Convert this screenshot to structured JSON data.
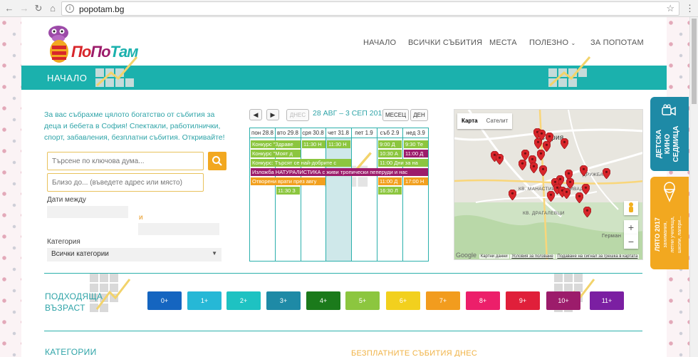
{
  "browser": {
    "url": "popotam.bg",
    "back_icon": "arrow-left-icon",
    "forward_icon": "arrow-right-icon",
    "reload_icon": "reload-icon",
    "home_icon": "home-icon"
  },
  "logo": {
    "text_parts": [
      "По",
      "По",
      "Там"
    ]
  },
  "nav": {
    "items": [
      "НАЧАЛО",
      "ВСИЧКИ СЪБИТИЯ",
      "МЕСТА",
      "ПОЛЕЗНО",
      "ЗА ПОПОТАМ"
    ]
  },
  "banner": {
    "title": "НАЧАЛО"
  },
  "intro": {
    "text": "За вас събрахме цялото богатство от събития за деца и бебета в София! Спектакли, работилнички, спорт, забавления, безплатни събития. Откривайте!"
  },
  "search": {
    "keyword_placeholder": "Търсене по ключова дума...",
    "near_placeholder": "Близо до... (въведете адрес или място)",
    "dates_label": "Дати между",
    "and_label": "и",
    "category_label": "Категория",
    "category_value": "Всички категории"
  },
  "calendar": {
    "today_label": "ДНЕС",
    "range": "28 АВГ – 3 СЕП 2017",
    "month_label": "МЕСЕЦ",
    "day_label": "ДЕН",
    "days": [
      "пон 28.8",
      "вто 29.8",
      "сря 30.8",
      "чет 31.8",
      "пет 1.9",
      "съб 2.9",
      "нед 3.9"
    ],
    "events": [
      {
        "text": "Конкурс \"Здраве",
        "color": "#8cc63f"
      },
      {
        "text": "Конкурс \"Моят д",
        "color": "#8cc63f"
      },
      {
        "text": "Конкурс: Търсят се най-добрите с",
        "color": "#8cc63f"
      },
      {
        "text": "11:30 Н",
        "color": "#8cc63f"
      },
      {
        "text": "11:30 Н",
        "color": "#8cc63f"
      },
      {
        "text": "9:00 Д",
        "color": "#8cc63f"
      },
      {
        "text": "9:30 Те",
        "color": "#8cc63f"
      },
      {
        "text": "10:30 А",
        "color": "#8cc63f"
      },
      {
        "text": "11:00 Д",
        "color": "#9c1c6b"
      },
      {
        "text": "11:00 Дни за на",
        "color": "#8cc63f"
      },
      {
        "text": "Изложба НАТУРАЛИСТИКА с живи тропически пеперуди и нас",
        "color": "#9c1c6b"
      },
      {
        "text": "Отворени врати през авгу",
        "color": "#f2a01e"
      },
      {
        "text": "11:00 Д",
        "color": "#f2a01e"
      },
      {
        "text": "17:00 Н",
        "color": "#f2a01e"
      },
      {
        "text": "11:30 З",
        "color": "#8cc63f"
      },
      {
        "text": "16:30 Л",
        "color": "#8cc63f"
      }
    ]
  },
  "map": {
    "tab_map": "Карта",
    "tab_satellite": "Сателит",
    "city_label": "София",
    "district_labels": [
      "КВ. МАНАСТИРСКИ ЛИВАДИ",
      "КВ. ДРАГАЛЕВЦИ",
      "Герман",
      "ДРУЖБА"
    ],
    "google_label": "Google",
    "attrib_data": "Картни данни",
    "attrib_terms": "Условия за ползване",
    "attrib_report": "Подаване на сигнал за грешка в картата",
    "zoom_in": "+",
    "zoom_out": "−",
    "pin_color": "#d8262b"
  },
  "ages": {
    "title_line1": "ПОДХОДЯЩА",
    "title_line2": "ВЪЗРАСТ",
    "items": [
      {
        "label": "0+",
        "color": "#1565c0"
      },
      {
        "label": "1+",
        "color": "#26b8d6"
      },
      {
        "label": "2+",
        "color": "#1ec2c2"
      },
      {
        "label": "3+",
        "color": "#1e8aa6"
      },
      {
        "label": "4+",
        "color": "#1b7a1b"
      },
      {
        "label": "5+",
        "color": "#8cc63f"
      },
      {
        "label": "6+",
        "color": "#f2d01e"
      },
      {
        "label": "7+",
        "color": "#f29c1e"
      },
      {
        "label": "8+",
        "color": "#ec1f6a"
      },
      {
        "label": "9+",
        "color": "#e01f3a"
      },
      {
        "label": "10+",
        "color": "#9c1c6b"
      },
      {
        "label": "11+",
        "color": "#7b1fa2"
      }
    ]
  },
  "sections": {
    "categories_title": "КАТЕГОРИИ",
    "free_events_title": "БЕЗПЛАТНИТЕ СЪБИТИЯ ДНЕС"
  },
  "side_tabs": {
    "cinema_line1": "ДЕТСКА",
    "cinema_line2": "КИНО",
    "cinema_line3": "СЕДМИЦА",
    "summer_line1": "ЛЯТО 2017",
    "summer_line2": "занимания,",
    "summer_line3": "летни училища,",
    "summer_line4": "школи, лагери..."
  },
  "colors": {
    "accent": "#1bb1ad",
    "orange": "#f2a820"
  }
}
